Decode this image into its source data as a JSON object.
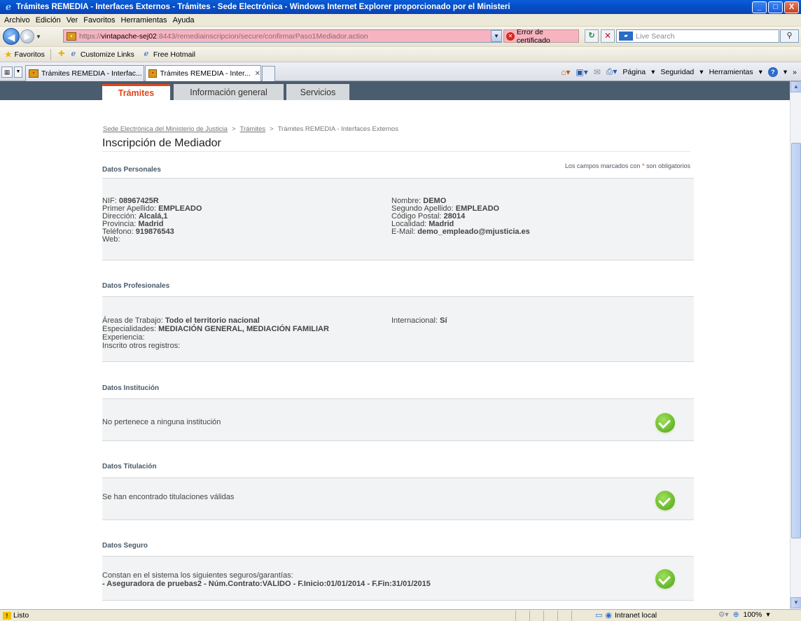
{
  "window": {
    "title": "Trámites REMEDIA - Interfaces Externos - Trámites - Sede Electrónica - Windows Internet Explorer proporcionado por el Ministeri",
    "minimize": "_",
    "maximize": "□",
    "close": "X"
  },
  "menu": [
    "Archivo",
    "Edición",
    "Ver",
    "Favoritos",
    "Herramientas",
    "Ayuda"
  ],
  "address": {
    "url_scheme": "https://",
    "url_host": "vintapache-sej02",
    "url_rest": ":8443/remediainscripcion/secure/confirmarPaso1Mediador.action",
    "cert_error": "Error de certificado",
    "search_placeholder": "Live Search"
  },
  "favorites": {
    "label": "Favoritos",
    "items": [
      "Customize Links",
      "Free Hotmail"
    ]
  },
  "browser_tabs": [
    {
      "label": "Trámites REMEDIA - Interfac..."
    },
    {
      "label": "Trámites REMEDIA - Inter..."
    }
  ],
  "command_bar": {
    "page": "Página",
    "security": "Seguridad",
    "tools": "Herramientas"
  },
  "site_tabs": [
    "Trámites",
    "Información general",
    "Servicios"
  ],
  "breadcrumb": {
    "items": [
      "Sede Electrónica del Ministerio de Justicia",
      "Trámites",
      "Trámites REMEDIA - Interfaces Externos"
    ],
    "separator": ">"
  },
  "page_title": "Inscripción de Mediador",
  "required_note": {
    "before": "Los campos marcados con ",
    "asterisk": "*",
    "after": " son obligatorios"
  },
  "personal": {
    "heading": "Datos Personales",
    "left": [
      {
        "label": "NIF: ",
        "value": "08967425R"
      },
      {
        "label": "Primer Apellido: ",
        "value": "EMPLEADO"
      },
      {
        "label": "Dirección: ",
        "value": "Alcalá,1"
      },
      {
        "label": "Provincia: ",
        "value": "Madrid"
      },
      {
        "label": "Teléfono: ",
        "value": "919876543"
      },
      {
        "label": "Web:",
        "value": ""
      }
    ],
    "right": [
      {
        "label": "Nombre: ",
        "value": "DEMO"
      },
      {
        "label": "Segundo Apellido: ",
        "value": "EMPLEADO"
      },
      {
        "label": "Código Postal: ",
        "value": "28014"
      },
      {
        "label": "Localidad: ",
        "value": "Madrid"
      },
      {
        "label": "E-Mail: ",
        "value": "demo_empleado@mjusticia.es"
      }
    ]
  },
  "professional": {
    "heading": "Datos Profesionales",
    "left": [
      {
        "label": "Áreas de Trabajo: ",
        "value": "Todo el territorio nacional"
      },
      {
        "label": "Especialidades: ",
        "value": "MEDIACIÓN GENERAL, MEDIACIÓN FAMILIAR"
      },
      {
        "label": "Experiencia:",
        "value": ""
      },
      {
        "label": "Inscrito otros registros:",
        "value": ""
      }
    ],
    "right": [
      {
        "label": "Internacional: ",
        "value": "Sí"
      }
    ]
  },
  "institution": {
    "heading": "Datos Institución",
    "text": "No pertenece a ninguna institución"
  },
  "titulacion": {
    "heading": "Datos Titulación",
    "text": "Se han encontrado titulaciones válidas"
  },
  "seguro": {
    "heading": "Datos Seguro",
    "text": "Constan en el sistema los siguientes seguros/garantías:",
    "detail": "- Aseguradora de pruebas2 - Núm.Contrato:VALIDO - F.Inicio:01/01/2014 - F.Fin:31/01/2015"
  },
  "status": {
    "text": "Listo",
    "zone": "Intranet local",
    "zoom": "100%"
  },
  "colors": {
    "accent": "#e0461a",
    "nav_bar": "#4a5d6f",
    "ok_green": "#4ea314"
  }
}
